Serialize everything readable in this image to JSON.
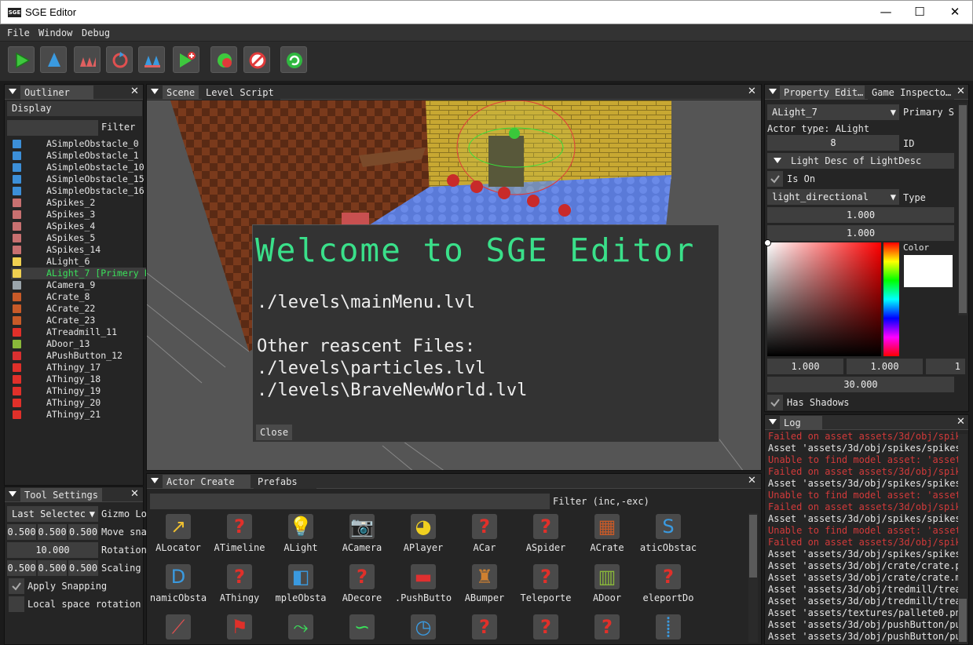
{
  "window": {
    "title": "SGE Editor",
    "logo": "SGE",
    "minimize": "—",
    "maximize": "☐",
    "close": "✕"
  },
  "menu": [
    "File",
    "Window",
    "Debug"
  ],
  "toolbar_icons": [
    "play-icon",
    "obstacle-icon",
    "spikes-icon",
    "rotate-icon",
    "wave-icon",
    "add-play-icon",
    "swap-icon",
    "no-icon",
    "refresh-icon"
  ],
  "outliner": {
    "tab": "Outliner",
    "display": "Display",
    "filter_label": "Filter",
    "items": [
      {
        "name": "ASimpleObstacle_0",
        "icon": "obstacle-icon",
        "color": "#3c8fd8"
      },
      {
        "name": "ASimpleObstacle_1",
        "icon": "obstacle-icon",
        "color": "#3c8fd8"
      },
      {
        "name": "ASimpleObstacle_10",
        "icon": "obstacle-icon",
        "color": "#3c8fd8"
      },
      {
        "name": "ASimpleObstacle_15",
        "icon": "obstacle-icon",
        "color": "#3c8fd8"
      },
      {
        "name": "ASimpleObstacle_16",
        "icon": "obstacle-icon",
        "color": "#3c8fd8"
      },
      {
        "name": "ASpikes_2",
        "icon": "spikes-icon",
        "color": "#c87070"
      },
      {
        "name": "ASpikes_3",
        "icon": "spikes-icon",
        "color": "#c87070"
      },
      {
        "name": "ASpikes_4",
        "icon": "spikes-icon",
        "color": "#c87070"
      },
      {
        "name": "ASpikes_5",
        "icon": "spikes-icon",
        "color": "#c87070"
      },
      {
        "name": "ASpikes_14",
        "icon": "spikes-icon",
        "color": "#c87070"
      },
      {
        "name": "ALight_6",
        "icon": "bulb-icon",
        "color": "#f0d050"
      },
      {
        "name": "ALight_7 [Primery Light]",
        "icon": "bulb-icon",
        "color": "#f0d050"
      },
      {
        "name": "ACamera_9",
        "icon": "camera-icon",
        "color": "#9aa4aa"
      },
      {
        "name": "ACrate_8",
        "icon": "crate-icon",
        "color": "#c85a28"
      },
      {
        "name": "ACrate_22",
        "icon": "crate-icon",
        "color": "#c85a28"
      },
      {
        "name": "ACrate_23",
        "icon": "crate-icon",
        "color": "#c85a28"
      },
      {
        "name": "ATreadmill_11",
        "icon": "question-icon",
        "color": "#e0302a"
      },
      {
        "name": "ADoor_13",
        "icon": "door-icon",
        "color": "#8ab83a"
      },
      {
        "name": "APushButton_12",
        "icon": "button-icon",
        "color": "#d83030"
      },
      {
        "name": "AThingy_17",
        "icon": "question-icon",
        "color": "#e0302a"
      },
      {
        "name": "AThingy_18",
        "icon": "question-icon",
        "color": "#e0302a"
      },
      {
        "name": "AThingy_19",
        "icon": "question-icon",
        "color": "#e0302a"
      },
      {
        "name": "AThingy_20",
        "icon": "question-icon",
        "color": "#e0302a"
      },
      {
        "name": "AThingy_21",
        "icon": "question-icon",
        "color": "#e0302a"
      }
    ]
  },
  "scene": {
    "tabs": [
      "Scene",
      "Level Script"
    ]
  },
  "welcome": {
    "title": "Welcome to SGE Editor",
    "current": "./levels\\mainMenu.lvl",
    "recent_heading": "Other reascent Files:",
    "recent": [
      "./levels\\particles.lvl",
      "./levels\\BraveNewWorld.lvl"
    ],
    "close": "Close"
  },
  "tool_settings": {
    "tab": "Tool Settings",
    "select_mode": "Last Selectec",
    "gizmo_label": "Gizmo Lo",
    "move": [
      "0.500",
      "0.500",
      "0.500"
    ],
    "move_label": "Move sna",
    "rotation": "10.000",
    "rotation_label": "Rotation",
    "scaling": [
      "0.500",
      "0.500",
      "0.500"
    ],
    "scaling_label": "Scaling",
    "apply_snapping": "Apply Snapping",
    "local_rotation": "Local space rotation"
  },
  "actor_create": {
    "tabs": [
      "Actor Create",
      "Prefabs"
    ],
    "filter_label": "Filter (inc,-exc)",
    "row1": [
      {
        "name": "ALocator",
        "icon": "locator-icon"
      },
      {
        "name": "ATimeline",
        "icon": "question-icon"
      },
      {
        "name": "ALight",
        "icon": "bulb-icon"
      },
      {
        "name": "ACamera",
        "icon": "camera-icon"
      },
      {
        "name": "APlayer",
        "icon": "player-icon"
      },
      {
        "name": "ACar",
        "icon": "question-icon"
      },
      {
        "name": "ASpider",
        "icon": "question-icon"
      },
      {
        "name": "ACrate",
        "icon": "crate-icon"
      },
      {
        "name": "aticObstac",
        "icon": "static-obstacle-icon"
      }
    ],
    "row2": [
      {
        "name": "namicObsta",
        "icon": "dynamic-obstacle-icon"
      },
      {
        "name": "AThingy",
        "icon": "question-icon"
      },
      {
        "name": "mpleObsta",
        "icon": "simple-obstacle-icon"
      },
      {
        "name": "ADecore",
        "icon": "question-icon"
      },
      {
        "name": ".PushButto",
        "icon": "button-icon"
      },
      {
        "name": "ABumper",
        "icon": "bumper-icon"
      },
      {
        "name": "Teleporte",
        "icon": "question-icon"
      },
      {
        "name": "ADoor",
        "icon": "door-icon"
      },
      {
        "name": "eleportDo",
        "icon": "question-icon"
      }
    ],
    "row3": [
      "lever-icon",
      "flag-icon",
      "path-icon",
      "path2-icon",
      "timer-icon",
      "question-icon",
      "question-icon",
      "question-icon",
      "footsteps-icon"
    ]
  },
  "property_editor": {
    "tabs": [
      "Property Edit…",
      "Game Inspecto…"
    ],
    "actor": "ALight_7",
    "primary_label": "Primary S",
    "actor_type": "Actor type: ALight",
    "id_value": "8",
    "id_label": "ID",
    "light_desc": "Light Desc of LightDesc",
    "is_on": "Is On",
    "light_type": "light_directional",
    "type_label": "Type",
    "intensity": "1.000",
    "ambient": "1.000",
    "color_label": "Color",
    "rgb": [
      "1.000",
      "1.000",
      "1"
    ],
    "range": "30.000",
    "has_shadows": "Has Shadows"
  },
  "log": {
    "tab": "Log",
    "error_color": "#d23a3a",
    "lines": [
      {
        "text": "Failed on asset assets/3d/obj/spik",
        "err": true
      },
      {
        "text": "Asset 'assets/3d/obj/spikes/spikes",
        "err": false
      },
      {
        "text": "Unable to find model asset: 'asset",
        "err": true
      },
      {
        "text": "Failed on asset assets/3d/obj/spik",
        "err": true
      },
      {
        "text": "Asset 'assets/3d/obj/spikes/spikes",
        "err": false
      },
      {
        "text": "Unable to find model asset: 'asset",
        "err": true
      },
      {
        "text": "Failed on asset assets/3d/obj/spik",
        "err": true
      },
      {
        "text": "Asset 'assets/3d/obj/spikes/spikes",
        "err": false
      },
      {
        "text": "Unable to find model asset: 'asset",
        "err": true
      },
      {
        "text": "Failed on asset assets/3d/obj/spik",
        "err": true
      },
      {
        "text": "Asset 'assets/3d/obj/spikes/spikes",
        "err": false
      },
      {
        "text": "Asset 'assets/3d/obj/crate/crate.p",
        "err": false
      },
      {
        "text": "Asset 'assets/3d/obj/crate/crate.m",
        "err": false
      },
      {
        "text": "Asset 'assets/3d/obj/tredmill/trea",
        "err": false
      },
      {
        "text": "Asset 'assets/3d/obj/tredmill/trea",
        "err": false
      },
      {
        "text": "Asset 'assets/textures/pallete0.pn",
        "err": false
      },
      {
        "text": "Asset 'assets/3d/obj/pushButton/pu",
        "err": false
      },
      {
        "text": "Asset 'assets/3d/obj/pushButton/pu",
        "err": false
      }
    ]
  }
}
